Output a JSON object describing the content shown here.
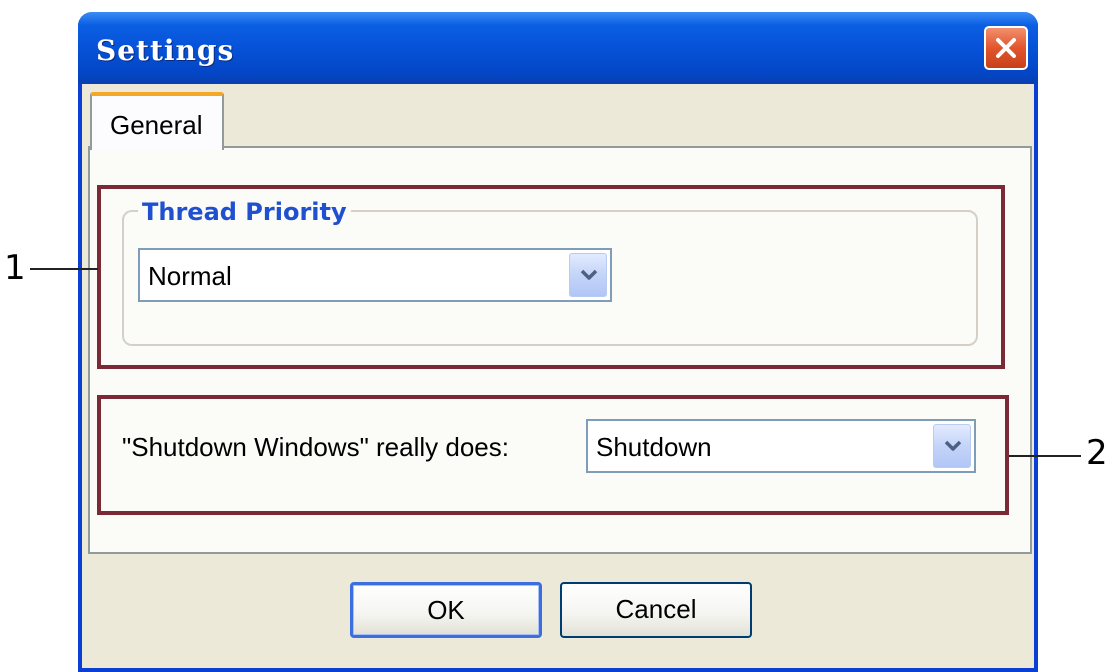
{
  "window": {
    "title": "Settings"
  },
  "tabs": [
    {
      "label": "General"
    }
  ],
  "thread_priority": {
    "group_title": "Thread Priority",
    "selected": "Normal"
  },
  "shutdown": {
    "label": "\"Shutdown Windows\" really does:",
    "selected": "Shutdown"
  },
  "buttons": {
    "ok_label": "OK",
    "cancel_label": "Cancel"
  },
  "annotations": [
    {
      "number": "1"
    },
    {
      "number": "2"
    }
  ],
  "colors": {
    "titlebar": "#0652d8",
    "window_border": "#0a3fd3",
    "tab_highlight": "#f4a825",
    "group_title": "#1e50d0",
    "annotation_box": "#7b2a35",
    "close_button": "#e2552c"
  },
  "icons": {
    "close": "close-icon",
    "combo_arrow": "chevron-down-icon"
  }
}
